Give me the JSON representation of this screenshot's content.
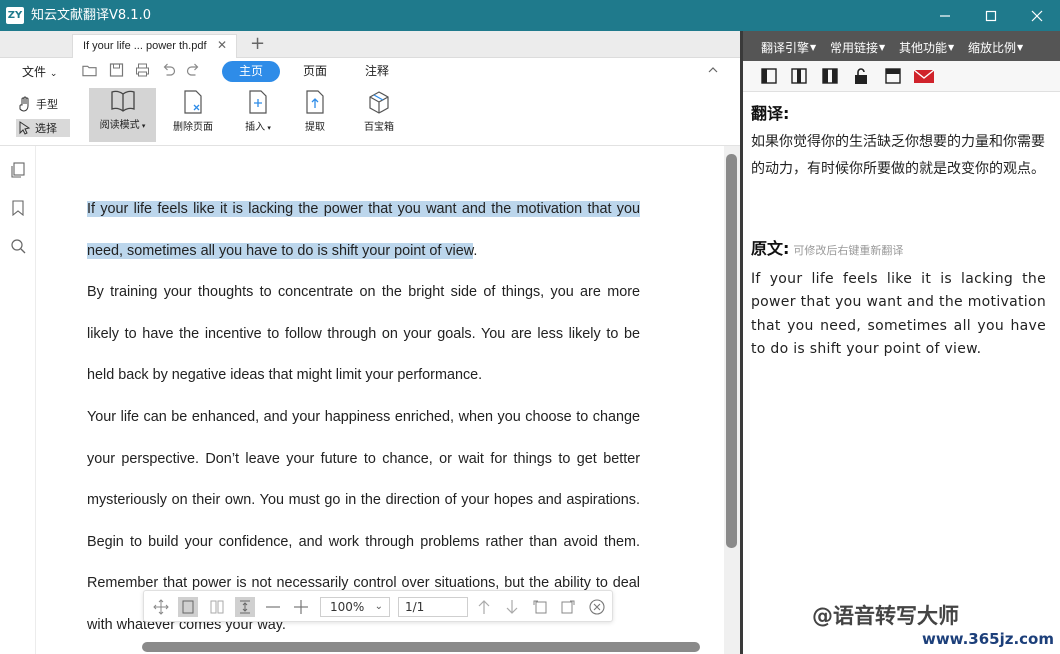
{
  "window": {
    "logo": "ZY",
    "title": "知云文献翻译V8.1.0"
  },
  "tabs": [
    {
      "label": "If your life ... power th.pdf"
    }
  ],
  "ribbon": {
    "file_menu": "文件",
    "tabs": [
      "主页",
      "页面",
      "注释"
    ],
    "active_tab": "主页",
    "accent_color": "#2e8ce8",
    "tools": {
      "hand": "手型",
      "select": "选择",
      "read_mode": "阅读模式",
      "delete_page": "删除页面",
      "insert": "插入",
      "extract": "提取",
      "toolbox": "百宝箱"
    }
  },
  "document": {
    "paragraphs": [
      {
        "highlighted": "If your life feels like it is lacking the power that you want and the motivation that you need, sometimes all you have to do is shift your point of view",
        "rest": "."
      },
      {
        "text": "By training your thoughts to concentrate on the bright side of things, you are more likely to have the incentive to follow through on your goals. You are less likely to be held back by negative ideas that might limit your performance."
      },
      {
        "text": "Your life can be enhanced, and your happiness enriched, when you choose to change your perspective. Don’t leave your future to chance, or wait for things to get better mysteriously on their own. You must go in the direction of your hopes and aspirations. Begin to build your confidence, and work through problems rather than avoid them. Remember that power is not necessarily control over situations, but the ability to deal with whatever comes your way."
      }
    ],
    "highlight_color": "#bcd6ec"
  },
  "bottom_toolbar": {
    "zoom": "100%",
    "page": "1/1"
  },
  "right_panel": {
    "menu": [
      "翻译引擎",
      "常用链接",
      "其他功能",
      "缩放比例"
    ],
    "translation_heading": "翻译:",
    "translation_text": "如果你觉得你的生活缺乏你想要的力量和你需要的动力，有时候你所要做的就是改变你的观点。",
    "source_heading": "原文:",
    "source_hint": "可修改后右键重新翻译",
    "source_text": "If your life feels like it is lacking the power that you want and the motivation that you need, sometimes all you have to do is shift your point of view."
  },
  "watermark": {
    "line1": "@语音转写大师",
    "line2": "www.365jz.com"
  }
}
